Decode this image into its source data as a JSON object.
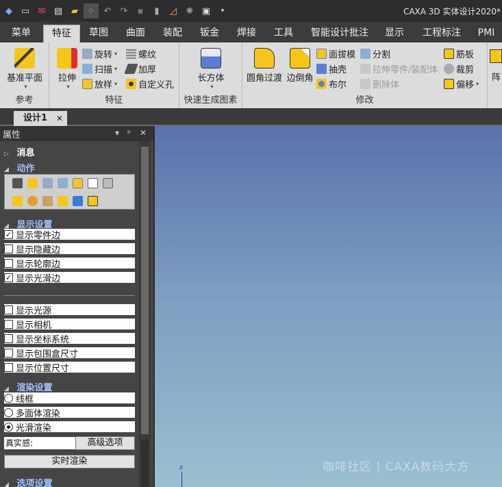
{
  "window": {
    "title": "CAXA 3D 实体设计2020*"
  },
  "quick_access": [
    {
      "icon": "app-logo-icon"
    },
    {
      "icon": "new-file-icon"
    },
    {
      "icon": "mail-icon"
    },
    {
      "icon": "import-icon"
    },
    {
      "icon": "open-folder-icon"
    },
    {
      "icon": "wizard-icon"
    },
    {
      "icon": "undo-icon"
    },
    {
      "icon": "redo-icon"
    },
    {
      "icon": "gray-box-icon"
    },
    {
      "icon": "bar-icon"
    },
    {
      "icon": "triangle-ruler-icon"
    },
    {
      "icon": "gear-icon"
    },
    {
      "icon": "save-icon"
    },
    {
      "icon": "customize-dropdown-icon"
    }
  ],
  "menu_tabs": [
    "菜单",
    "特征",
    "草图",
    "曲面",
    "装配",
    "钣金",
    "焊接",
    "工具",
    "智能设计批注",
    "显示",
    "工程标注",
    "PMI"
  ],
  "active_tab": "特征",
  "ribbon": {
    "groups": [
      {
        "label": "参考",
        "big": [
          {
            "label": "基准平面",
            "caret": "▾"
          }
        ]
      },
      {
        "label": "特征",
        "big": [
          {
            "label": "拉伸",
            "caret": "▾"
          }
        ],
        "small": [
          {
            "label": "旋转",
            "caret": "▾"
          },
          {
            "label": "扫描",
            "caret": "▾"
          },
          {
            "label": "放样",
            "caret": "▾"
          },
          {
            "label": "螺纹"
          },
          {
            "label": "加厚"
          },
          {
            "label": "自定义孔"
          }
        ]
      },
      {
        "label": "快速生成图素",
        "big": [
          {
            "label": "长方体",
            "caret": "▾"
          }
        ]
      },
      {
        "label": "修改",
        "big": [
          {
            "label": "圆角过渡"
          },
          {
            "label": "边倒角"
          }
        ],
        "small": [
          {
            "label": "面拔模"
          },
          {
            "label": "抽壳"
          },
          {
            "label": "布尔"
          },
          {
            "label": "分割"
          },
          {
            "label": "拉伸零件/装配体",
            "disabled": true
          },
          {
            "label": "删除体",
            "disabled": true
          },
          {
            "label": "筋板"
          },
          {
            "label": "裁剪"
          },
          {
            "label": "偏移",
            "caret": "▾"
          }
        ]
      },
      {
        "label": "阵",
        "big": []
      }
    ]
  },
  "doc_tab": {
    "label": "设计1",
    "close": "✕"
  },
  "panel": {
    "title": "属性",
    "controls": {
      "dropdown": "▾",
      "pin": "ᵖ",
      "close": "✕"
    },
    "sections": {
      "messages": "消息",
      "actions": "动作",
      "display": "显示设置",
      "render": "渲染设置",
      "options": "选项设置"
    },
    "arrows": {
      "collapsed": "▷",
      "expanded": "◢"
    },
    "display_items": [
      {
        "label": "显示零件边",
        "checked": true
      },
      {
        "label": "显示隐藏边",
        "checked": false
      },
      {
        "label": "显示轮廓边",
        "checked": false
      },
      {
        "label": "显示光滑边",
        "checked": true
      },
      {
        "label": "显示光源",
        "checked": false
      },
      {
        "label": "显示相机",
        "checked": false
      },
      {
        "label": "显示坐标系统",
        "checked": false
      },
      {
        "label": "显示包围盒尺寸",
        "checked": false
      },
      {
        "label": "显示位置尺寸",
        "checked": false
      }
    ],
    "render_items": [
      {
        "label": "线框",
        "selected": false
      },
      {
        "label": "多面体渲染",
        "selected": false
      },
      {
        "label": "光滑渲染",
        "selected": true
      }
    ],
    "realism_label": "真实感:",
    "advanced_button": "高级选项",
    "realtime_button": "实时渲染",
    "check_mark": "✓"
  },
  "viewport": {
    "watermark": "咖啡社区 | CAXA数码大方",
    "axis_label": "z"
  }
}
